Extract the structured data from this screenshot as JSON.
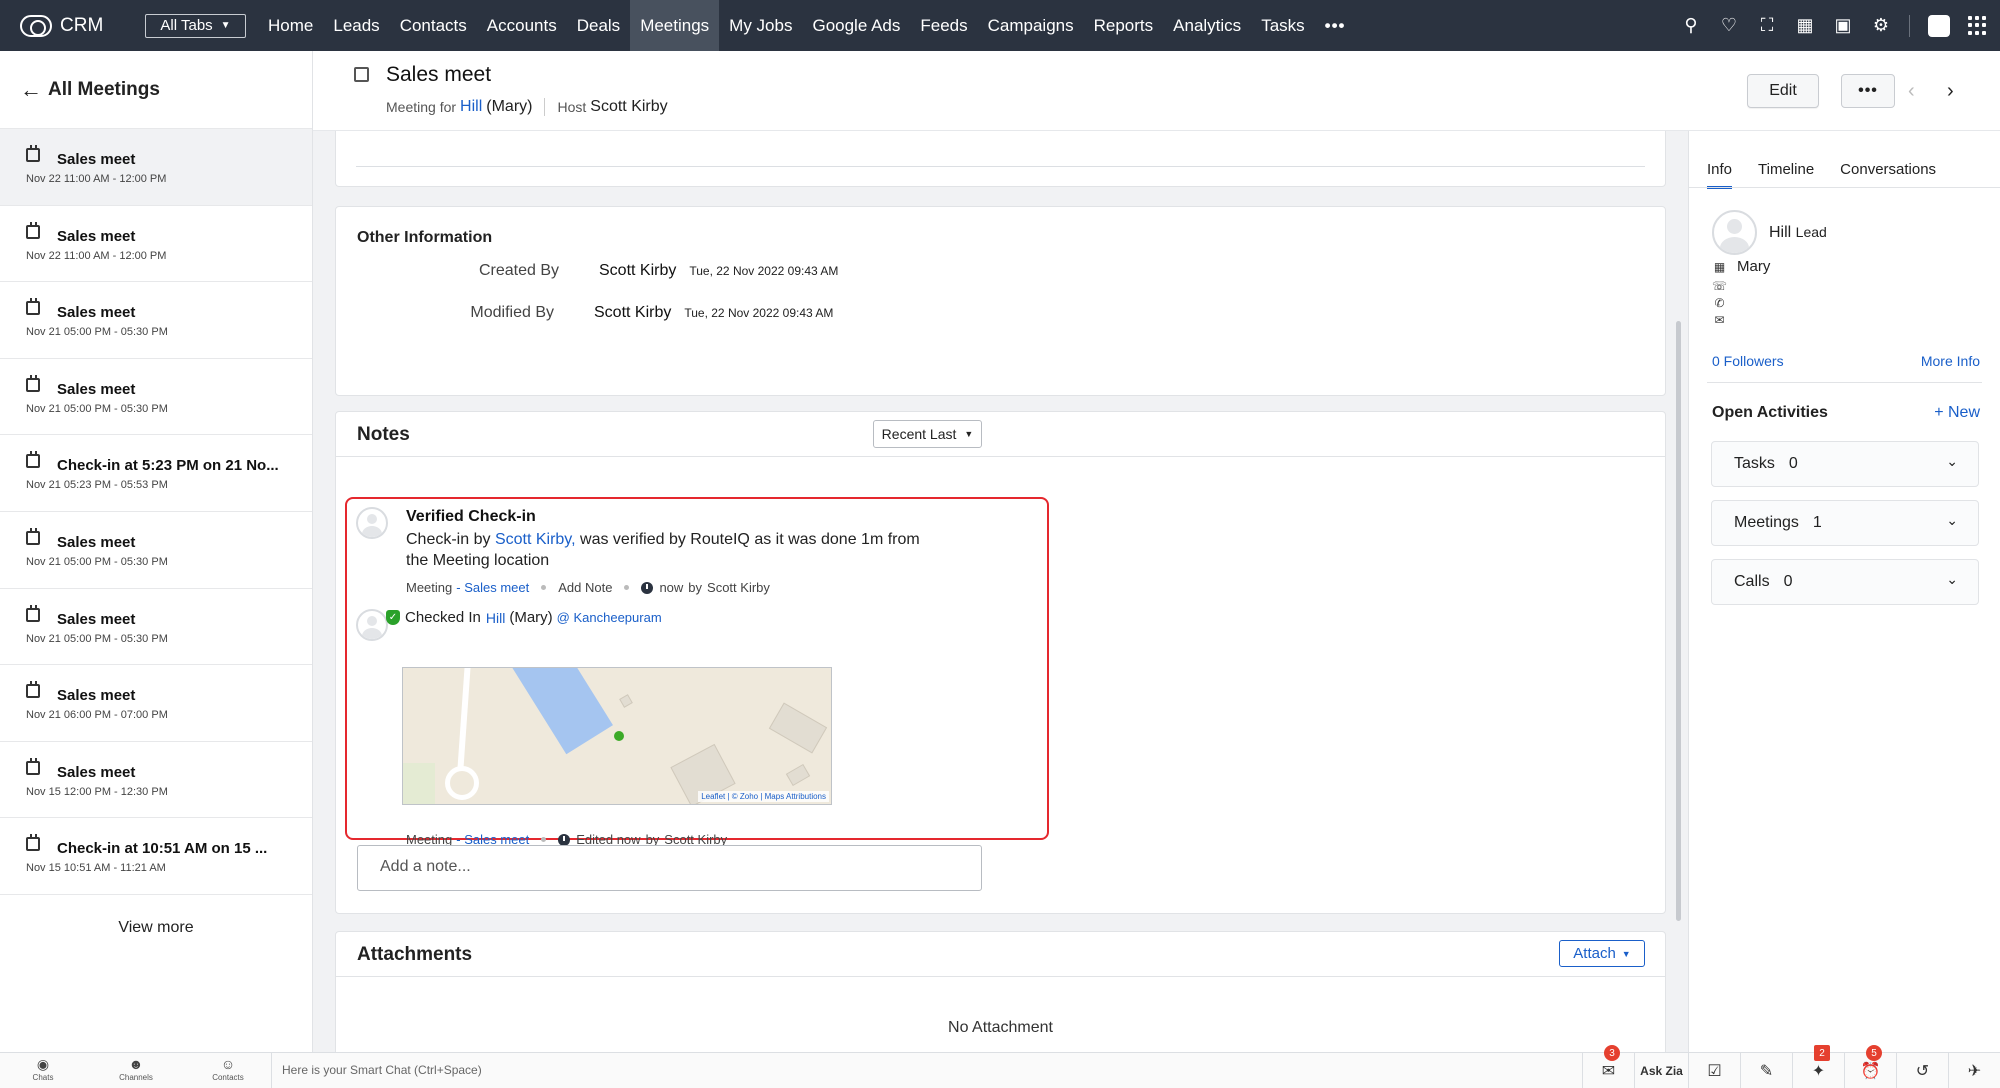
{
  "topnav": {
    "brand": "CRM",
    "all_tabs": "All Tabs",
    "tabs": [
      "Home",
      "Leads",
      "Contacts",
      "Accounts",
      "Deals",
      "Meetings",
      "My Jobs",
      "Google Ads",
      "Feeds",
      "Campaigns",
      "Reports",
      "Analytics",
      "Tasks"
    ],
    "active_tab": "Meetings",
    "more": "•••"
  },
  "sidebar": {
    "back_label": "All Meetings",
    "items": [
      {
        "title": "Sales meet",
        "time": "Nov 22 11:00 AM - 12:00 PM"
      },
      {
        "title": "Sales meet",
        "time": "Nov 22 11:00 AM - 12:00 PM"
      },
      {
        "title": "Sales meet",
        "time": "Nov 21 05:00 PM - 05:30 PM"
      },
      {
        "title": "Sales meet",
        "time": "Nov 21 05:00 PM - 05:30 PM"
      },
      {
        "title": "Check-in at 5:23 PM on 21 No...",
        "time": "Nov 21 05:23 PM - 05:53 PM"
      },
      {
        "title": "Sales meet",
        "time": "Nov 21 05:00 PM - 05:30 PM"
      },
      {
        "title": "Sales meet",
        "time": "Nov 21 05:00 PM - 05:30 PM"
      },
      {
        "title": "Sales meet",
        "time": "Nov 21 06:00 PM - 07:00 PM"
      },
      {
        "title": "Sales meet",
        "time": "Nov 15 12:00 PM - 12:30 PM"
      },
      {
        "title": "Check-in at 10:51 AM on 15 ...",
        "time": "Nov 15 10:51 AM - 11:21 AM"
      }
    ],
    "view_more": "View more"
  },
  "header": {
    "title": "Sales meet",
    "meeting_for_label": "Meeting for",
    "meeting_for_link": "Hill",
    "meeting_for_rest": "(Mary)",
    "host_label": "Host",
    "host_value": "Scott Kirby",
    "edit": "Edit",
    "more": "•••"
  },
  "other_info": {
    "title": "Other Information",
    "created_label": "Created By",
    "created_by": "Scott Kirby",
    "created_time": "Tue, 22 Nov 2022 09:43 AM",
    "modified_label": "Modified By",
    "modified_by": "Scott Kirby",
    "modified_time": "Tue, 22 Nov 2022 09:43 AM"
  },
  "notes": {
    "title": "Notes",
    "sort": "Recent Last",
    "note1_title": "Verified Check-in",
    "note1_prefix": "Check-in by",
    "note1_user": "Scott Kirby,",
    "note1_rest": "was verified by RouteIQ as it was done 1m from the Meeting location",
    "meta1_module": "Meeting",
    "meta1_link": "- Sales meet",
    "meta1_action": "Add Note",
    "meta1_time": "now",
    "meta1_by": "by",
    "meta1_user": "Scott Kirby",
    "checked_in_label": "Checked In",
    "checked_in_link": "Hill",
    "checked_in_rest": "(Mary)",
    "checked_in_location": "@ Kancheepuram",
    "map_attribution": "Leaflet | © Zoho | Maps Attributions",
    "meta2_module": "Meeting",
    "meta2_link": "- Sales meet",
    "meta2_time": "Edited now",
    "meta2_by": "by",
    "meta2_user": "Scott Kirby",
    "add_note_placeholder": "Add a note..."
  },
  "attachments": {
    "title": "Attachments",
    "attach": "Attach",
    "empty": "No Attachment"
  },
  "right_panel": {
    "tabs": [
      "Info",
      "Timeline",
      "Conversations"
    ],
    "contact_name": "Hill",
    "contact_type": "Lead",
    "company": "Mary",
    "followers": "0 Followers",
    "more_info": "More Info",
    "open_activities": "Open Activities",
    "new": "+ New",
    "activities": [
      {
        "label": "Tasks",
        "count": "0"
      },
      {
        "label": "Meetings",
        "count": "1"
      },
      {
        "label": "Calls",
        "count": "0"
      }
    ]
  },
  "bottombar": {
    "chats": "Chats",
    "channels": "Channels",
    "contacts": "Contacts",
    "smart_chat": "Here is your Smart Chat (Ctrl+Space)",
    "ask_zia": "Ask Zia",
    "badge_announce": "3",
    "badge_zia": "2",
    "badge_alarm": "5"
  },
  "colors": {
    "nav_bg": "#2b3340",
    "link": "#1a5fc9",
    "highlight_border": "#e5282e",
    "badge": "#e5402f"
  }
}
